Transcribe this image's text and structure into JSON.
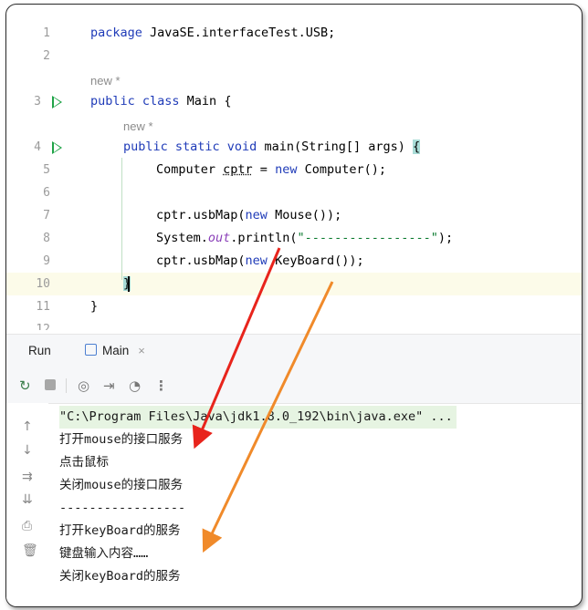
{
  "editor": {
    "lines": [
      {
        "num": "1",
        "code": "package JavaSE.interfaceTest.USB;"
      },
      {
        "num": "2",
        "code": ""
      },
      {
        "num": "3",
        "code": "public class Main {"
      },
      {
        "num": "4",
        "code": "public static void main(String[] args) {"
      },
      {
        "num": "5",
        "code": "Computer cptr = new Computer();"
      },
      {
        "num": "6",
        "code": ""
      },
      {
        "num": "7",
        "code": "cptr.usbMap(new Mouse());"
      },
      {
        "num": "8",
        "code": "System.out.println(\"-----------------\");"
      },
      {
        "num": "9",
        "code": "cptr.usbMap(new KeyBoard());"
      },
      {
        "num": "10",
        "code": "}"
      },
      {
        "num": "11",
        "code": "}"
      },
      {
        "num": "12",
        "code": ""
      }
    ],
    "hints": [
      "new *",
      "new *"
    ]
  },
  "run_panel": {
    "run_label": "Run",
    "tab_label": "Main",
    "tab_close": "×"
  },
  "toolbar": {
    "icons": [
      "rerun-icon",
      "stop-icon",
      "camera-icon",
      "exit-icon",
      "coverage-icon",
      "more-icon"
    ]
  },
  "console": {
    "lines": [
      "\"C:\\Program Files\\Java\\jdk1.8.0_192\\bin\\java.exe\" ...",
      "打开mouse的接口服务",
      "点击鼠标",
      "关闭mouse的接口服务",
      "-----------------",
      "打开keyBoard的服务",
      "键盘输入内容……",
      "关闭keyBoard的服务"
    ]
  },
  "colors": {
    "keyword": "#1f3bb8",
    "string": "#0b7b2f",
    "arrow_red": "#e8241c",
    "arrow_orange": "#f08a2a",
    "run_green": "#1fa347"
  }
}
